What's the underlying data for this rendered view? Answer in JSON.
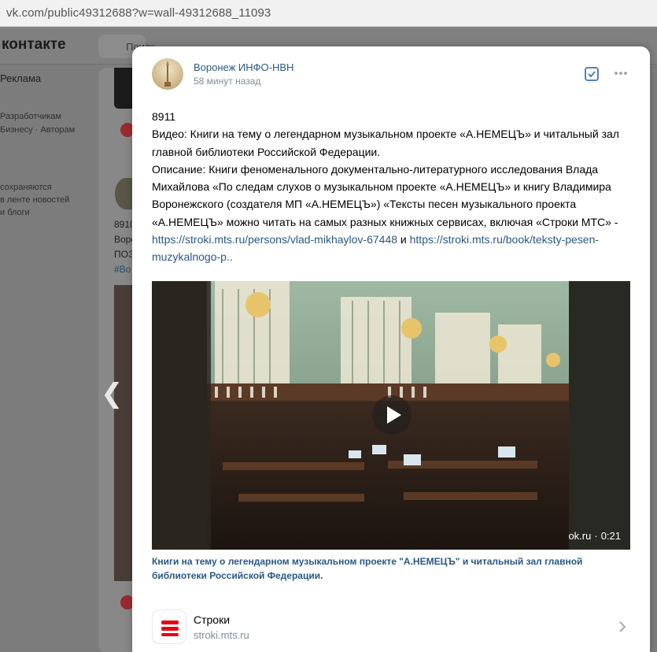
{
  "browser": {
    "address": "vk.com/public49312688?w=wall-49312688_11093"
  },
  "background": {
    "logo": "контакте",
    "search_placeholder": "Поиск",
    "sidebar_item": "Реклама",
    "sidebar_links": [
      "Разработчикам",
      "Бизнесу · Авторам"
    ],
    "sidebar_note": [
      "сохраняются",
      "в ленте новостей",
      "и блоги"
    ],
    "post_text": [
      "8910",
      "Воро",
      "ПОЭ",
      "#Во"
    ]
  },
  "post": {
    "author": "Воронеж ИНФО-НВН",
    "time": "58 минут назад",
    "lines": {
      "id": "8911",
      "video_line": "Видео: Книги на тему о легендарном музыкальном проекте «А.НЕМЕЦЪ» и читальный зал главной библиотеки Российской Федерации.",
      "description": "Описание: Книги феноменального документально-литературного исследования Влада Михайлова «По следам слухов о музыкальном проекте «А.НЕМЕЦЪ» и книгу Владимира Воронежского (создателя МП «А.НЕМЕЦЪ») «Тексты песен музыкального проекта «А.НЕМЕЦЪ» можно читать на самых разных книжных сервисах, включая «Строки МТС» - ",
      "link1": "https://stroki.mts.ru/persons/vlad-mikhaylov-67448",
      "and": " и ",
      "link2": "https://stroki.mts.ru/book/teksty-pesen-muzykalnogo-p.."
    },
    "video": {
      "source": "ok.ru",
      "duration": "0:21",
      "caption": "Книги на тему о легендарном музыкальном проекте \"А.НЕМЕЦЪ\" и читальный зал главной библиотеки Российской Федерации."
    },
    "link_card": {
      "title": "Строки",
      "domain": "stroki.mts.ru"
    }
  },
  "colors": {
    "link": "#2a5885",
    "meta": "#818c99",
    "brand_red": "#e30611"
  }
}
